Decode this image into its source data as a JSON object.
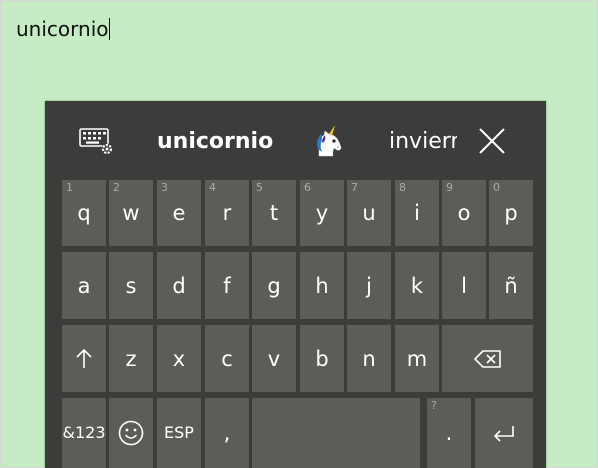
{
  "text_field": {
    "value": "unicornio"
  },
  "suggestion_bar": {
    "primary": "unicornio",
    "emoji": "🦄",
    "secondary": "invierno",
    "settings_icon": "keyboard-settings-icon",
    "close_icon": "close-icon"
  },
  "rows": {
    "row1": [
      {
        "label": "q",
        "num": "1"
      },
      {
        "label": "w",
        "num": "2"
      },
      {
        "label": "e",
        "num": "3"
      },
      {
        "label": "r",
        "num": "4"
      },
      {
        "label": "t",
        "num": "5"
      },
      {
        "label": "y",
        "num": "6"
      },
      {
        "label": "u",
        "num": "7"
      },
      {
        "label": "i",
        "num": "8"
      },
      {
        "label": "o",
        "num": "9"
      },
      {
        "label": "p",
        "num": "0"
      }
    ],
    "row2": [
      {
        "label": "a"
      },
      {
        "label": "s"
      },
      {
        "label": "d"
      },
      {
        "label": "f"
      },
      {
        "label": "g"
      },
      {
        "label": "h"
      },
      {
        "label": "j"
      },
      {
        "label": "k"
      },
      {
        "label": "l"
      },
      {
        "label": "ñ"
      }
    ],
    "row3": [
      {
        "label": "z"
      },
      {
        "label": "x"
      },
      {
        "label": "c"
      },
      {
        "label": "v"
      },
      {
        "label": "b"
      },
      {
        "label": "n"
      },
      {
        "label": "m"
      }
    ]
  },
  "bottom_row": {
    "symbols": "&123",
    "language": "ESP",
    "comma": ",",
    "period": ".",
    "period_alt": "?"
  },
  "colors": {
    "background": "#c6ecc4",
    "keyboard": "#3a3d39",
    "key": "#5a5e57"
  }
}
